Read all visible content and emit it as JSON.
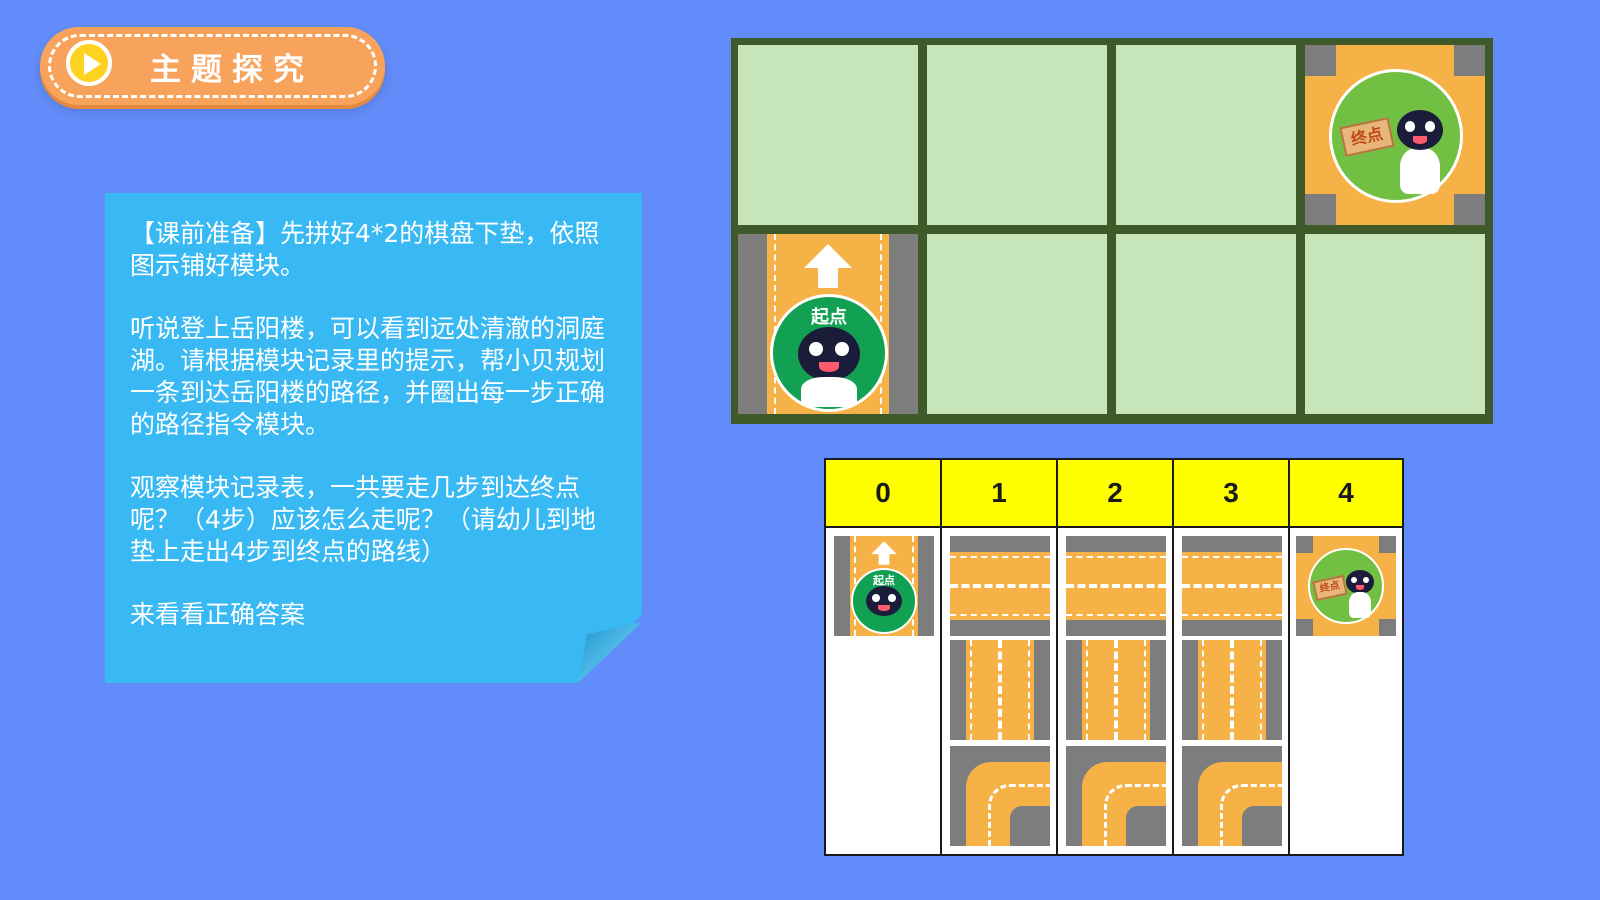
{
  "header": {
    "title": "主题探究",
    "play_icon": "play-icon"
  },
  "note": {
    "paragraphs": [
      "【课前准备】先拼好4*2的棋盘下垫，依照图示铺好模块。",
      "听说登上岳阳楼，可以看到远处清澈的洞庭湖。请根据模块记录里的提示，帮小贝规划一条到达岳阳楼的路径，并圈出每一步正确的路径指令模块。",
      "观察模块记录表，一共要走几步到达终点呢？（4步）应该怎么走呢？（请幼儿到地垫上走出4步到终点的路线）",
      "来看看正确答案"
    ]
  },
  "board": {
    "start_label": "起点",
    "end_label": "终点"
  },
  "record_table": {
    "headers": [
      "0",
      "1",
      "2",
      "3",
      "4"
    ],
    "start_label": "起点",
    "end_label": "终点",
    "option_icons": [
      "horizontal-road-icon",
      "vertical-road-icon",
      "turn-road-icon"
    ]
  },
  "colors": {
    "background": "#628cf9",
    "note": "#39b9f3",
    "badge": "#f7a35c",
    "mat": "#3d5a28",
    "mat_cell": "#c6e5b8",
    "road": "#f6b246",
    "header_yellow": "#ffff00"
  }
}
